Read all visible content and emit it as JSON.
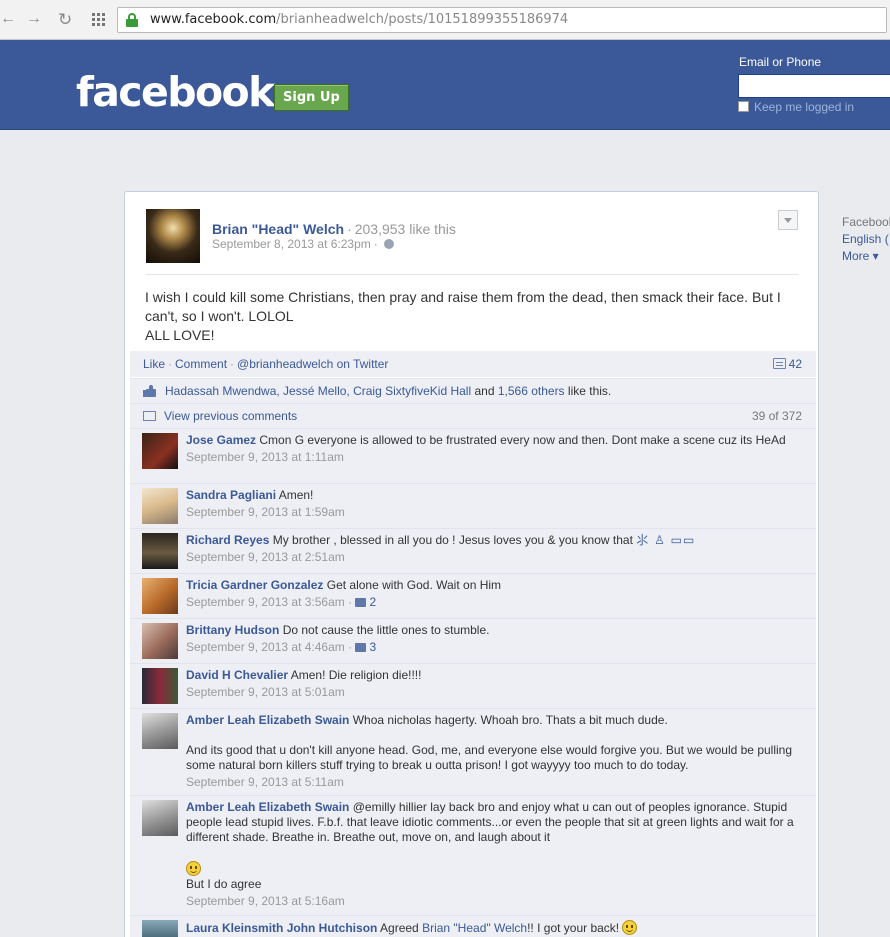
{
  "browser": {
    "url_host": "www.facebook.com",
    "url_path": "/brianheadwelch/posts/10151899355186974"
  },
  "header": {
    "logo": "facebook",
    "signup_label": "Sign Up",
    "email_label": "Email or Phone",
    "keep_logged_in": "Keep me logged in"
  },
  "rail": {
    "title": "Facebook",
    "language": "English (",
    "more": "More ▾"
  },
  "post": {
    "author": "Brian \"Head\" Welch",
    "likes": "203,953 like this",
    "date": "September 8, 2013 at 6:23pm",
    "text_line1": "I wish I could kill some Christians, then pray and raise them from the dead, then smack their face. But I can't, so I won't. LOLOL",
    "text_line2": "ALL LOVE!"
  },
  "ufi": {
    "like": "Like",
    "comment": "Comment",
    "twitter": "@brianheadwelch on Twitter",
    "comment_count": "42",
    "likers": "Hadassah Mwendwa, Jessé Mello, Craig SixtyfiveKid Hall",
    "and": "and",
    "others": "1,566 others",
    "like_this": "like this.",
    "view_previous": "View previous comments",
    "shown_count": "39 of 372"
  },
  "comments": [
    {
      "name": "Jose Gamez",
      "text": "Cmon G everyone is allowed to be frustrated every now and then. Dont make a scene cuz its HeAd",
      "time": "September 9, 2013 at 1:11am",
      "likes": "",
      "color": "#2a1a12"
    },
    {
      "name": "Sandra Pagliani",
      "text": "Amen!",
      "time": "September 9, 2013 at 1:59am",
      "likes": "",
      "color": "#e8d6b8"
    },
    {
      "name": "Richard Reyes",
      "text": "My brother , blessed in all you do ! Jesus loves you & you know that",
      "glyphs": "⺢ ♙ ▭▭",
      "time": "September 9, 2013 at 2:51am",
      "likes": "",
      "color": "#4a4132"
    },
    {
      "name": "Tricia Gardner Gonzalez",
      "text": "Get alone with God. Wait on Him",
      "time": "September 9, 2013 at 3:56am",
      "likes": "2",
      "color": "#c48a3a"
    },
    {
      "name": "Brittany Hudson",
      "text": "Do not cause the little ones to stumble.",
      "time": "September 9, 2013 at 4:46am",
      "likes": "3",
      "color": "#a88070"
    },
    {
      "name": "David H Chevalier",
      "text": "Amen! Die religion die!!!!",
      "time": "September 9, 2013 at 5:01am",
      "likes": "",
      "color": "#5a2e2a"
    },
    {
      "name": "Amber Leah Elizabeth Swain",
      "text": "Whoa nicholas hagerty. Whoah bro. Thats a bit much dude.",
      "text2": "And its good that u don't kill anyone head. God, me, and everyone else would forgive you. But we would be pulling some natural born killers stuff trying to break u outta prison! I got wayyyy too much to do today.",
      "time": "September 9, 2013 at 5:11am",
      "likes": "",
      "color": "#9a9a9a"
    },
    {
      "name": "Amber Leah Elizabeth Swain",
      "text": "@emilly hillier lay back bro and enjoy what u can out of peoples ignorance. Stupid people lead stupid lives. F.b.f. that leave idiotic comments...or even the people that sit at green lights and wait for a different shade. Breathe in. Breathe out, move on, and laugh about it",
      "text3": "But I do agree",
      "time": "September 9, 2013 at 5:16am",
      "likes": "",
      "color": "#9a9a9a"
    },
    {
      "name": "Laura Kleinsmith John Hutchison",
      "text": "Agreed",
      "mention": "Brian \"Head\" Welch",
      "text_after": "!! I got your back!",
      "time": "",
      "likes": "",
      "color": "#4a6a7a"
    }
  ]
}
